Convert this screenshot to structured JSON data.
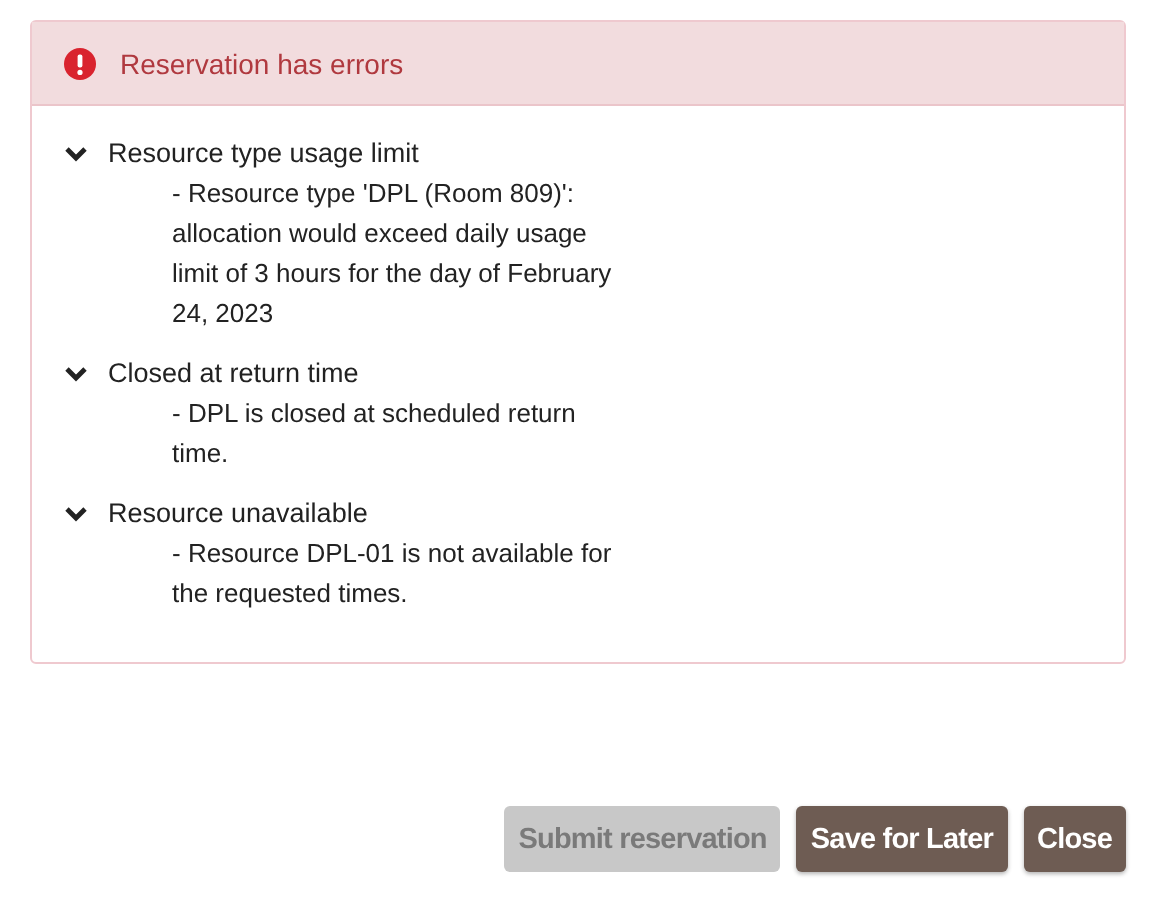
{
  "alert": {
    "title": "Reservation has errors",
    "errors": [
      {
        "title": "Resource type usage limit",
        "expanded": true,
        "detail": "- Resource type 'DPL (Room 809)': allocation would exceed daily usage limit of 3 hours for the day of February 24, 2023"
      },
      {
        "title": "Closed at return time",
        "expanded": true,
        "detail": "- DPL is closed at scheduled return time."
      },
      {
        "title": "Resource unavailable",
        "expanded": true,
        "detail": "- Resource DPL-01 is not available for the requested times."
      }
    ]
  },
  "buttons": [
    {
      "label": "Submit reservation",
      "disabled": true
    },
    {
      "label": "Save for Later",
      "disabled": false
    },
    {
      "label": "Close",
      "disabled": false
    }
  ]
}
